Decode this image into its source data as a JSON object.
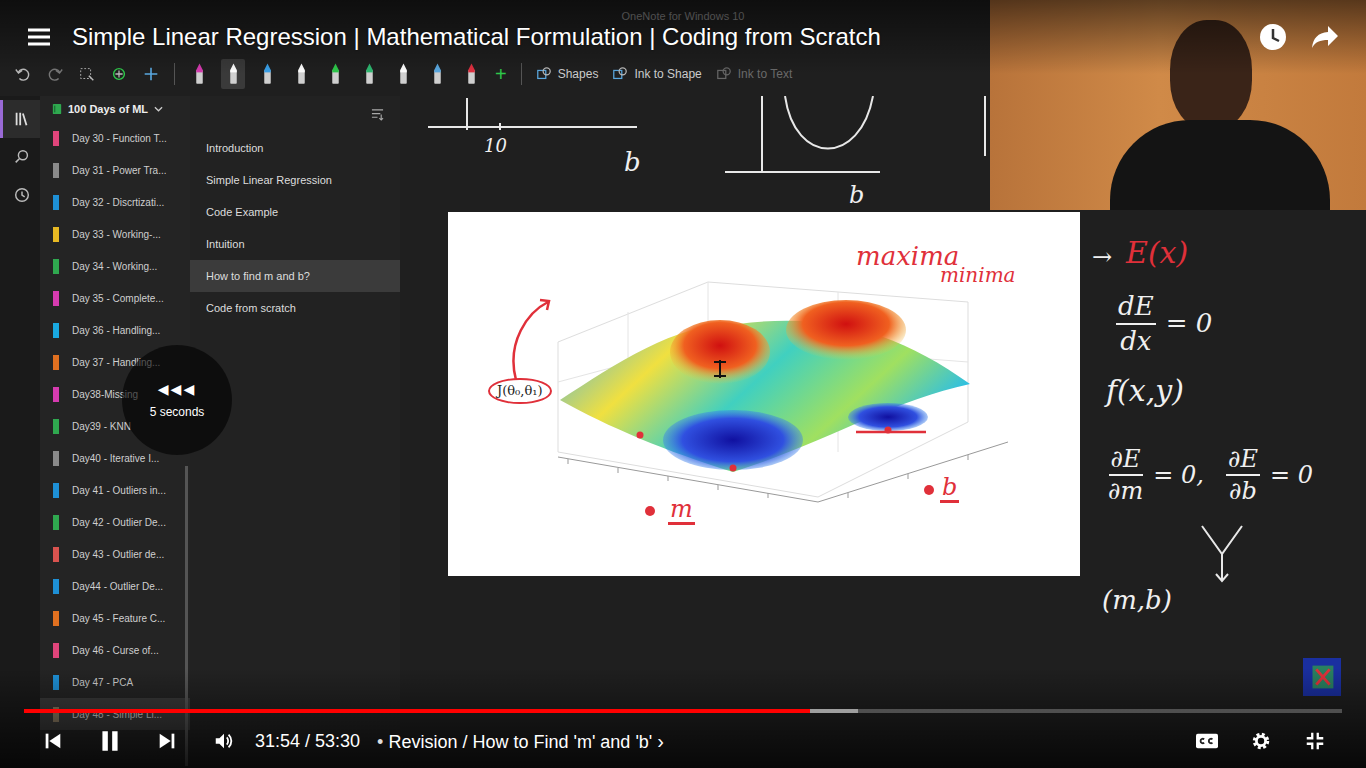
{
  "player": {
    "title": "Simple Linear Regression | Mathematical Formulation | Coding from Scratch",
    "time": "31:54 / 53:30",
    "bullet": "•",
    "chapter": "Revision / How to Find 'm' and 'b'",
    "chapter_arrow": "›",
    "playing": true,
    "played": 0.596,
    "buffered": 0.633,
    "seek": {
      "glyph": "◀◀◀",
      "label": "5 seconds"
    }
  },
  "app": {
    "title": "OneNote for Windows 10",
    "notebook": "100 Days of ML",
    "toolbar": {
      "pens": [
        {
          "color": "#d63bb0",
          "selected": false
        },
        {
          "color": "#ffffff",
          "selected": true
        },
        {
          "color": "#3aa0e8",
          "selected": false
        },
        {
          "color": "#ffffff",
          "selected": false
        },
        {
          "color": "#2ec84a",
          "selected": false
        },
        {
          "color": "#2eb870",
          "selected": false
        },
        {
          "color": "#ffffff",
          "selected": false
        },
        {
          "color": "#5aa8e0",
          "selected": false
        },
        {
          "color": "#e03040",
          "selected": false
        }
      ],
      "add": "+",
      "actions": [
        {
          "label": "Shapes",
          "disabled": false
        },
        {
          "label": "Ink to Shape",
          "disabled": false
        },
        {
          "label": "Ink to Text",
          "disabled": true
        }
      ]
    },
    "pages": [
      {
        "label": "Day 30 - Function T...",
        "color": "#e0457b",
        "selected": false
      },
      {
        "label": "Day 31 - Power Tra...",
        "color": "#8a8a8a",
        "selected": false
      },
      {
        "label": "Day 32 - Discrtizati...",
        "color": "#1e90d6",
        "selected": false
      },
      {
        "label": "Day 33 - Working-...",
        "color": "#e8b923",
        "selected": false
      },
      {
        "label": "Day 34 - Working...",
        "color": "#2fa84f",
        "selected": false
      },
      {
        "label": "Day 35 - Complete...",
        "color": "#d63bb0",
        "selected": false
      },
      {
        "label": "Day 36 - Handling...",
        "color": "#19a8e0",
        "selected": false
      },
      {
        "label": "Day 37 - Handling...",
        "color": "#e07020",
        "selected": false
      },
      {
        "label": "Day38-Missing",
        "color": "#d63bb0",
        "selected": false
      },
      {
        "label": "Day39 - KNN",
        "color": "#2fa84f",
        "selected": false
      },
      {
        "label": "Day40 - Iterative I...",
        "color": "#8a8a8a",
        "selected": false
      },
      {
        "label": "Day 41 - Outliers in...",
        "color": "#1e90d6",
        "selected": false
      },
      {
        "label": "Day 42 - Outlier De...",
        "color": "#2fa84f",
        "selected": false
      },
      {
        "label": "Day 43 - Outlier de...",
        "color": "#d9534f",
        "selected": false
      },
      {
        "label": "Day44 - Outlier De...",
        "color": "#1e90d6",
        "selected": false
      },
      {
        "label": "Day 45 - Feature C...",
        "color": "#e07020",
        "selected": false
      },
      {
        "label": "Day 46 - Curse of...",
        "color": "#e0457b",
        "selected": false
      },
      {
        "label": "Day 47 - PCA",
        "color": "#1e90d6",
        "selected": false
      },
      {
        "label": "Day 48 - Simple Li...",
        "color": "#8a7a60",
        "selected": true
      }
    ],
    "sections": [
      {
        "label": "Introduction",
        "selected": false
      },
      {
        "label": "Simple Linear Regression",
        "selected": false
      },
      {
        "label": "Code Example",
        "selected": false
      },
      {
        "label": "Intuition",
        "selected": false
      },
      {
        "label": "How to find m and b?",
        "selected": true
      },
      {
        "label": "Code from scratch",
        "selected": false
      }
    ]
  },
  "canvas": {
    "ink": [
      {
        "kind": "text",
        "text": "10",
        "color": "#f0f0f0"
      },
      {
        "kind": "text",
        "text": "b",
        "color": "#f0f0f0"
      },
      {
        "kind": "text",
        "text": "b",
        "color": "#f0f0f0"
      },
      {
        "kind": "text",
        "text": "maxima",
        "color": "#e0303a"
      },
      {
        "kind": "text",
        "text": "minima",
        "color": "#e0303a"
      },
      {
        "kind": "circled",
        "text": "J(θ₀,θ₁)",
        "color": "#e0303a"
      },
      {
        "kind": "underlined",
        "text": "m",
        "color": "#e0303a"
      },
      {
        "kind": "underlined",
        "text": "b",
        "color": "#e0303a"
      },
      {
        "kind": "text",
        "text": "→",
        "color": "#f0f0f0"
      },
      {
        "kind": "text",
        "text": "E(x)",
        "color": "#e0303a"
      },
      {
        "kind": "fraction",
        "num": "dE",
        "den": "dx",
        "after": "= 0",
        "color": "#f0f0f0"
      },
      {
        "kind": "text",
        "text": "f(x,y)",
        "color": "#f0f0f0"
      },
      {
        "kind": "fraction",
        "num": "∂E",
        "den": "∂m",
        "after": "= 0,",
        "color": "#f0f0f0"
      },
      {
        "kind": "fraction",
        "num": "∂E",
        "den": "∂b",
        "after": "= 0",
        "color": "#f0f0f0"
      },
      {
        "kind": "text",
        "text": "(m,b)",
        "color": "#f0f0f0"
      }
    ]
  }
}
